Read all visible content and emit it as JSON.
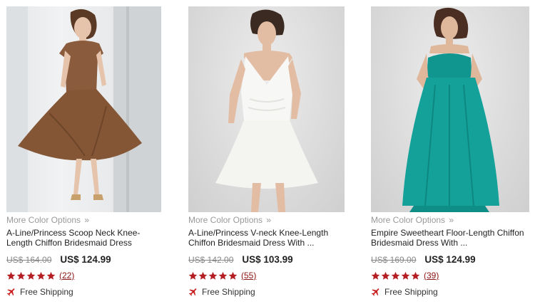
{
  "products": [
    {
      "more_colors": "More Color Options",
      "more_colors_arrow": "»",
      "title": "A-Line/Princess Scoop Neck Knee-Length Chiffon Bridesmaid Dress",
      "old_price": "US$ 164.00",
      "new_price": "US$ 124.99",
      "rating_stars": 5,
      "reviews": "(22)",
      "shipping": "Free Shipping",
      "dress_color": "#8a5b3c",
      "icon": "airplane-icon"
    },
    {
      "more_colors": "More Color Options",
      "more_colors_arrow": "»",
      "title": "A-Line/Princess V-neck Knee-Length Chiffon Bridesmaid Dress With ...",
      "old_price": "US$ 142.00",
      "new_price": "US$ 103.99",
      "rating_stars": 5,
      "reviews": "(55)",
      "shipping": "Free Shipping",
      "dress_color": "#f7f7f5",
      "icon": "airplane-icon"
    },
    {
      "more_colors": "More Color Options",
      "more_colors_arrow": "»",
      "title": "Empire Sweetheart Floor-Length Chiffon Bridesmaid Dress With ...",
      "old_price": "US$ 169.00",
      "new_price": "US$ 124.99",
      "rating_stars": 5,
      "reviews": "(39)",
      "shipping": "Free Shipping",
      "dress_color": "#10958f",
      "icon": "airplane-icon"
    }
  ],
  "colors": {
    "star": "#b51f24",
    "review_link": "#8b1414",
    "plane": "#c81e1e",
    "muted": "#999999"
  }
}
